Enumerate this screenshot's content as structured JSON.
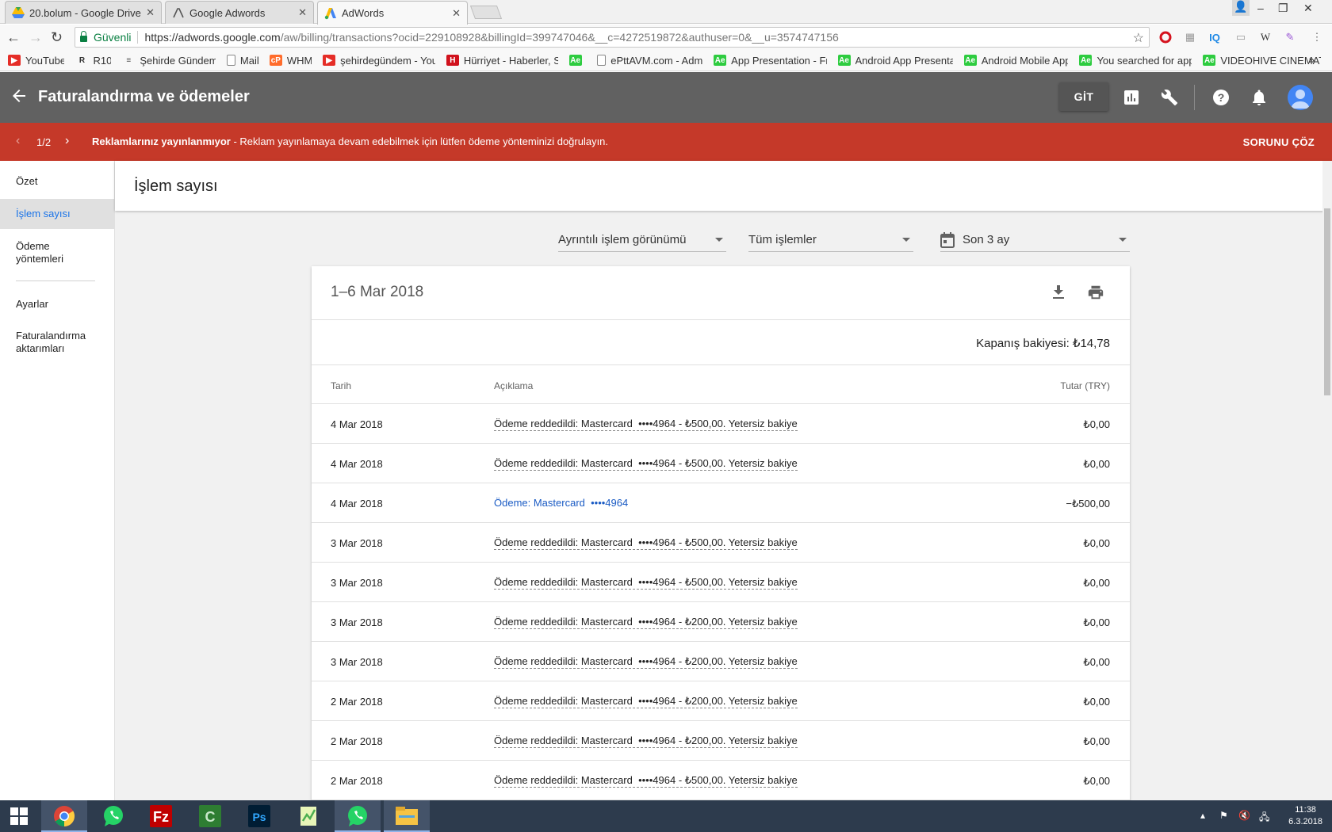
{
  "browser": {
    "tabs": [
      {
        "title": "20.bolum - Google Drive",
        "icon": "google-drive-icon",
        "active": false
      },
      {
        "title": "Google Adwords",
        "icon": "adwords-outline-icon",
        "active": false
      },
      {
        "title": "AdWords",
        "icon": "adwords-logo-icon",
        "active": true
      }
    ],
    "secure_label": "Güvenli",
    "url_host": "https://adwords.google.com",
    "url_path": "/aw/billing/transactions?ocid=229108928&billingId=399747046&__c=4272519872&authuser=0&__u=3574747156",
    "bookmarks": [
      {
        "label": "YouTube",
        "icon": "youtube-icon",
        "color": "#e52d27",
        "glyph": "▶"
      },
      {
        "label": "R10",
        "icon": "r10-icon",
        "color": "#333333",
        "glyph": "R"
      },
      {
        "label": "Şehirde Gündem",
        "icon": "news-icon",
        "color": "#555555",
        "glyph": "≡"
      },
      {
        "label": "Mail",
        "icon": "page-icon",
        "color": "#888888",
        "glyph": ""
      },
      {
        "label": "WHM",
        "icon": "cpanel-icon",
        "color": "#ff6c2c",
        "glyph": "cP"
      },
      {
        "label": "şehirdegündem - You",
        "icon": "youtube-icon",
        "color": "#e52d27",
        "glyph": "▶"
      },
      {
        "label": "Hürriyet - Haberler, S",
        "icon": "hurriyet-icon",
        "color": "#d1121d",
        "glyph": "H"
      },
      {
        "label": "",
        "icon": "envato-icon",
        "color": "#2ecc40",
        "glyph": "Ae"
      },
      {
        "label": "ePttAVM.com - Admi",
        "icon": "page-icon",
        "color": "#888888",
        "glyph": ""
      },
      {
        "label": "App Presentation - Fr",
        "icon": "envato-icon",
        "color": "#2ecc40",
        "glyph": "Ae"
      },
      {
        "label": "Android App Presenta",
        "icon": "envato-icon",
        "color": "#2ecc40",
        "glyph": "Ae"
      },
      {
        "label": "Android Mobile App",
        "icon": "envato-icon",
        "color": "#2ecc40",
        "glyph": "Ae"
      },
      {
        "label": "You searched for app",
        "icon": "envato-icon",
        "color": "#2ecc40",
        "glyph": "Ae"
      },
      {
        "label": "VIDEOHIVE CINEMAT",
        "icon": "envato-icon",
        "color": "#2ecc40",
        "glyph": "Ae"
      }
    ],
    "more_bookmarks": "»"
  },
  "header": {
    "title": "Faturalandırma ve ödemeler",
    "go_label": "GİT"
  },
  "alert": {
    "count": "1/2",
    "bold": "Reklamlarınız yayınlanmıyor",
    "message": " - Reklam yayınlamaya devam edebilmek için lütfen ödeme yönteminizi doğrulayın.",
    "action": "SORUNU ÇÖZ"
  },
  "sidebar": {
    "items": [
      {
        "label": "Özet"
      },
      {
        "label": "İşlem sayısı"
      },
      {
        "label": "Ödeme yöntemleri"
      },
      {
        "label": "Ayarlar"
      },
      {
        "label": "Faturalandırma aktarımları"
      }
    ]
  },
  "page": {
    "title": "İşlem sayısı",
    "filters": {
      "view": "Ayrıntılı işlem görünümü",
      "type": "Tüm işlemler",
      "range": "Son 3 ay"
    },
    "period": "1–6 Mar 2018",
    "closing_balance": "Kapanış bakiyesi: ₺14,78",
    "columns": {
      "date": "Tarih",
      "description": "Açıklama",
      "amount": "Tutar (TRY)"
    },
    "rows": [
      {
        "date": "4 Mar 2018",
        "desc": "Ödeme reddedildi: Mastercard  ••••4964 - ₺500,00. Yetersiz bakiye",
        "amount": "₺0,00",
        "link": false
      },
      {
        "date": "4 Mar 2018",
        "desc": "Ödeme reddedildi: Mastercard  ••••4964 - ₺500,00. Yetersiz bakiye",
        "amount": "₺0,00",
        "link": false
      },
      {
        "date": "4 Mar 2018",
        "desc": "Ödeme: Mastercard  ••••4964",
        "amount": "−₺500,00",
        "link": true
      },
      {
        "date": "3 Mar 2018",
        "desc": "Ödeme reddedildi: Mastercard  ••••4964 - ₺500,00. Yetersiz bakiye",
        "amount": "₺0,00",
        "link": false
      },
      {
        "date": "3 Mar 2018",
        "desc": "Ödeme reddedildi: Mastercard  ••••4964 - ₺500,00. Yetersiz bakiye",
        "amount": "₺0,00",
        "link": false
      },
      {
        "date": "3 Mar 2018",
        "desc": "Ödeme reddedildi: Mastercard  ••••4964 - ₺200,00. Yetersiz bakiye",
        "amount": "₺0,00",
        "link": false
      },
      {
        "date": "3 Mar 2018",
        "desc": "Ödeme reddedildi: Mastercard  ••••4964 - ₺200,00. Yetersiz bakiye",
        "amount": "₺0,00",
        "link": false
      },
      {
        "date": "2 Mar 2018",
        "desc": "Ödeme reddedildi: Mastercard  ••••4964 - ₺200,00. Yetersiz bakiye",
        "amount": "₺0,00",
        "link": false
      },
      {
        "date": "2 Mar 2018",
        "desc": "Ödeme reddedildi: Mastercard  ••••4964 - ₺200,00. Yetersiz bakiye",
        "amount": "₺0,00",
        "link": false
      },
      {
        "date": "2 Mar 2018",
        "desc": "Ödeme reddedildi: Mastercard  ••••4964 - ₺500,00. Yetersiz bakiye",
        "amount": "₺0,00",
        "link": false
      }
    ]
  },
  "taskbar": {
    "apps": [
      "windows-start-icon",
      "chrome-icon",
      "whatsapp-icon",
      "filezilla-icon",
      "camtasia-icon",
      "photoshop-icon",
      "notepad-plus-icon",
      "whatsapp-icon",
      "file-explorer-icon"
    ],
    "time": "11:38",
    "date": "6.3.2018"
  },
  "colors": {
    "header_bg": "#616161",
    "alert_bg": "#c53929",
    "link": "#1a5bc4",
    "active_nav": "#1a73e8"
  }
}
